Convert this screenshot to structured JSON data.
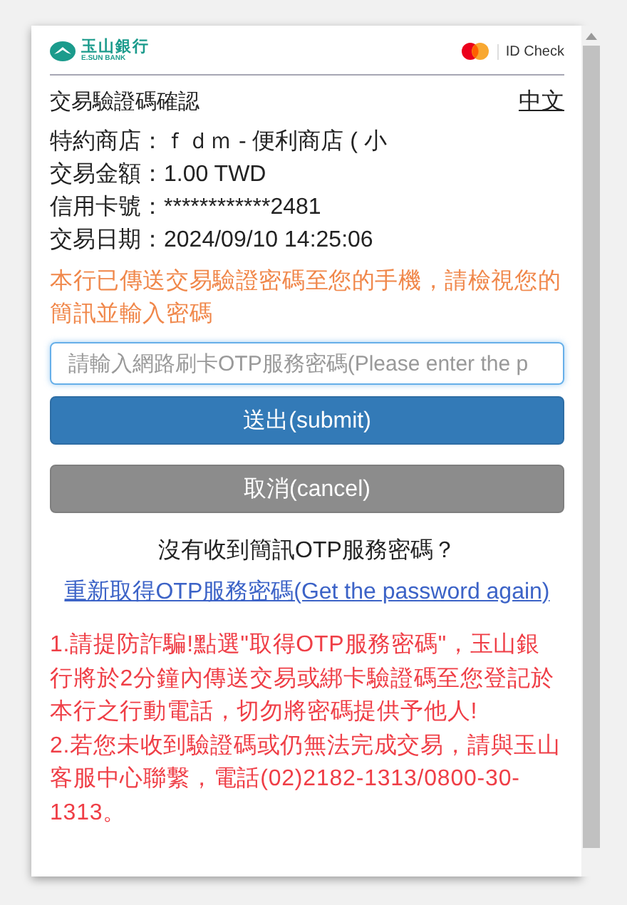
{
  "header": {
    "bank_name": "玉山銀行",
    "bank_name_en": "E.SUN BANK",
    "scheme_label": "ID Check"
  },
  "title": "交易驗證碼確認",
  "language_link": "中文",
  "details": [
    {
      "label": "特約商店：",
      "value": "ｆｄｍ - 便利商店 ( 小"
    },
    {
      "label": "交易金額：",
      "value": "1.00 TWD"
    },
    {
      "label": "信用卡號：",
      "value": "************2481"
    },
    {
      "label": "交易日期：",
      "value": "2024/09/10 14:25:06"
    }
  ],
  "notice": "本行已傳送交易驗證密碼至您的手機，請檢視您的簡訊並輸入密碼",
  "otp_field": {
    "placeholder": "請輸入網路刷卡OTP服務密碼(Please enter the p",
    "focused": true
  },
  "buttons": [
    {
      "label": "送出(submit)",
      "kind": "primary"
    },
    {
      "label": "取消(cancel)",
      "kind": "secondary"
    }
  ],
  "resend_question": "沒有收到簡訊OTP服務密碼？",
  "resend_link": "重新取得OTP服務密碼(Get the password again)",
  "notes": [
    "1.請提防詐騙!點選\"取得OTP服務密碼\"，玉山銀行將於2分鐘內傳送交易或綁卡驗證碼至您登記於本行之行動電話，切勿將密碼提供予他人!",
    "2.若您未收到驗證碼或仍無法完成交易，請與玉山客服中心聯繫，電話(02)2182-1313/0800-30-1313。"
  ]
}
